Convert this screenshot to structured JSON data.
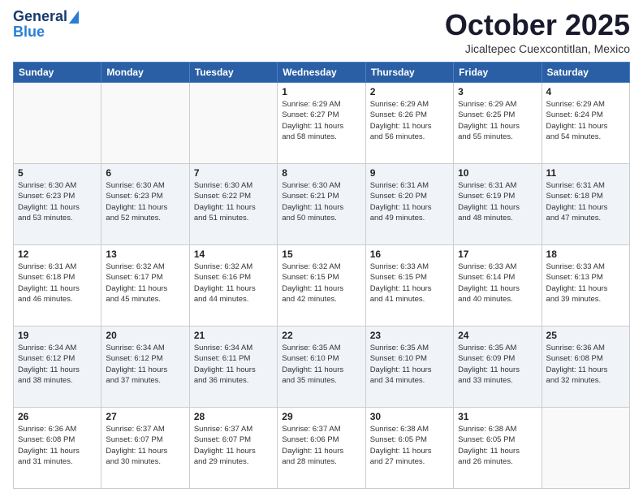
{
  "header": {
    "logo": {
      "line1": "General",
      "line2": "Blue"
    },
    "month": "October 2025",
    "location": "Jicaltepec Cuexcontitlan, Mexico"
  },
  "weekdays": [
    "Sunday",
    "Monday",
    "Tuesday",
    "Wednesday",
    "Thursday",
    "Friday",
    "Saturday"
  ],
  "weeks": [
    [
      {
        "day": "",
        "info": ""
      },
      {
        "day": "",
        "info": ""
      },
      {
        "day": "",
        "info": ""
      },
      {
        "day": "1",
        "info": "Sunrise: 6:29 AM\nSunset: 6:27 PM\nDaylight: 11 hours\nand 58 minutes."
      },
      {
        "day": "2",
        "info": "Sunrise: 6:29 AM\nSunset: 6:26 PM\nDaylight: 11 hours\nand 56 minutes."
      },
      {
        "day": "3",
        "info": "Sunrise: 6:29 AM\nSunset: 6:25 PM\nDaylight: 11 hours\nand 55 minutes."
      },
      {
        "day": "4",
        "info": "Sunrise: 6:29 AM\nSunset: 6:24 PM\nDaylight: 11 hours\nand 54 minutes."
      }
    ],
    [
      {
        "day": "5",
        "info": "Sunrise: 6:30 AM\nSunset: 6:23 PM\nDaylight: 11 hours\nand 53 minutes."
      },
      {
        "day": "6",
        "info": "Sunrise: 6:30 AM\nSunset: 6:23 PM\nDaylight: 11 hours\nand 52 minutes."
      },
      {
        "day": "7",
        "info": "Sunrise: 6:30 AM\nSunset: 6:22 PM\nDaylight: 11 hours\nand 51 minutes."
      },
      {
        "day": "8",
        "info": "Sunrise: 6:30 AM\nSunset: 6:21 PM\nDaylight: 11 hours\nand 50 minutes."
      },
      {
        "day": "9",
        "info": "Sunrise: 6:31 AM\nSunset: 6:20 PM\nDaylight: 11 hours\nand 49 minutes."
      },
      {
        "day": "10",
        "info": "Sunrise: 6:31 AM\nSunset: 6:19 PM\nDaylight: 11 hours\nand 48 minutes."
      },
      {
        "day": "11",
        "info": "Sunrise: 6:31 AM\nSunset: 6:18 PM\nDaylight: 11 hours\nand 47 minutes."
      }
    ],
    [
      {
        "day": "12",
        "info": "Sunrise: 6:31 AM\nSunset: 6:18 PM\nDaylight: 11 hours\nand 46 minutes."
      },
      {
        "day": "13",
        "info": "Sunrise: 6:32 AM\nSunset: 6:17 PM\nDaylight: 11 hours\nand 45 minutes."
      },
      {
        "day": "14",
        "info": "Sunrise: 6:32 AM\nSunset: 6:16 PM\nDaylight: 11 hours\nand 44 minutes."
      },
      {
        "day": "15",
        "info": "Sunrise: 6:32 AM\nSunset: 6:15 PM\nDaylight: 11 hours\nand 42 minutes."
      },
      {
        "day": "16",
        "info": "Sunrise: 6:33 AM\nSunset: 6:15 PM\nDaylight: 11 hours\nand 41 minutes."
      },
      {
        "day": "17",
        "info": "Sunrise: 6:33 AM\nSunset: 6:14 PM\nDaylight: 11 hours\nand 40 minutes."
      },
      {
        "day": "18",
        "info": "Sunrise: 6:33 AM\nSunset: 6:13 PM\nDaylight: 11 hours\nand 39 minutes."
      }
    ],
    [
      {
        "day": "19",
        "info": "Sunrise: 6:34 AM\nSunset: 6:12 PM\nDaylight: 11 hours\nand 38 minutes."
      },
      {
        "day": "20",
        "info": "Sunrise: 6:34 AM\nSunset: 6:12 PM\nDaylight: 11 hours\nand 37 minutes."
      },
      {
        "day": "21",
        "info": "Sunrise: 6:34 AM\nSunset: 6:11 PM\nDaylight: 11 hours\nand 36 minutes."
      },
      {
        "day": "22",
        "info": "Sunrise: 6:35 AM\nSunset: 6:10 PM\nDaylight: 11 hours\nand 35 minutes."
      },
      {
        "day": "23",
        "info": "Sunrise: 6:35 AM\nSunset: 6:10 PM\nDaylight: 11 hours\nand 34 minutes."
      },
      {
        "day": "24",
        "info": "Sunrise: 6:35 AM\nSunset: 6:09 PM\nDaylight: 11 hours\nand 33 minutes."
      },
      {
        "day": "25",
        "info": "Sunrise: 6:36 AM\nSunset: 6:08 PM\nDaylight: 11 hours\nand 32 minutes."
      }
    ],
    [
      {
        "day": "26",
        "info": "Sunrise: 6:36 AM\nSunset: 6:08 PM\nDaylight: 11 hours\nand 31 minutes."
      },
      {
        "day": "27",
        "info": "Sunrise: 6:37 AM\nSunset: 6:07 PM\nDaylight: 11 hours\nand 30 minutes."
      },
      {
        "day": "28",
        "info": "Sunrise: 6:37 AM\nSunset: 6:07 PM\nDaylight: 11 hours\nand 29 minutes."
      },
      {
        "day": "29",
        "info": "Sunrise: 6:37 AM\nSunset: 6:06 PM\nDaylight: 11 hours\nand 28 minutes."
      },
      {
        "day": "30",
        "info": "Sunrise: 6:38 AM\nSunset: 6:05 PM\nDaylight: 11 hours\nand 27 minutes."
      },
      {
        "day": "31",
        "info": "Sunrise: 6:38 AM\nSunset: 6:05 PM\nDaylight: 11 hours\nand 26 minutes."
      },
      {
        "day": "",
        "info": ""
      }
    ]
  ]
}
